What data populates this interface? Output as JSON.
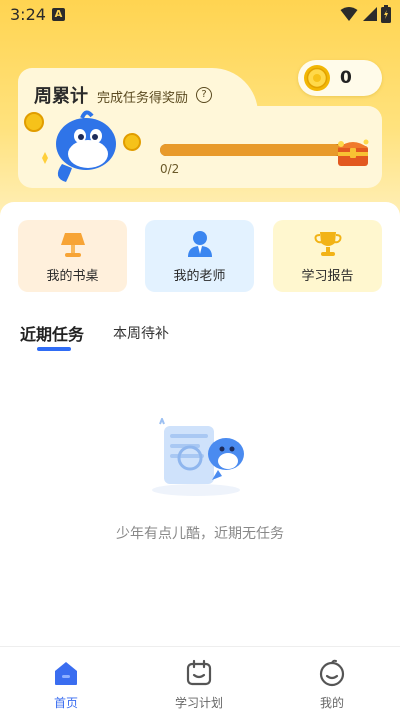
{
  "status_bar": {
    "time": "3:24",
    "notification_badge": "A"
  },
  "coins": {
    "count": "0"
  },
  "weekly": {
    "title": "周累计",
    "subtitle": "完成任务得奖励",
    "help_symbol": "?",
    "progress_text": "0/2",
    "progress_fraction": 0.95
  },
  "quick_actions": [
    {
      "label": "我的书桌"
    },
    {
      "label": "我的老师"
    },
    {
      "label": "学习报告"
    }
  ],
  "tabs": [
    {
      "label": "近期任务",
      "active": true
    },
    {
      "label": "本周待补",
      "active": false
    }
  ],
  "empty_state": {
    "message": "少年有点儿酷，近期无任务"
  },
  "bottom_nav": [
    {
      "label": "首页",
      "active": true
    },
    {
      "label": "学习计划",
      "active": false
    },
    {
      "label": "我的",
      "active": false
    }
  ],
  "colors": {
    "accent": "#3a6df0",
    "top_bg": "#ffd451",
    "progress": "#b1660f"
  }
}
